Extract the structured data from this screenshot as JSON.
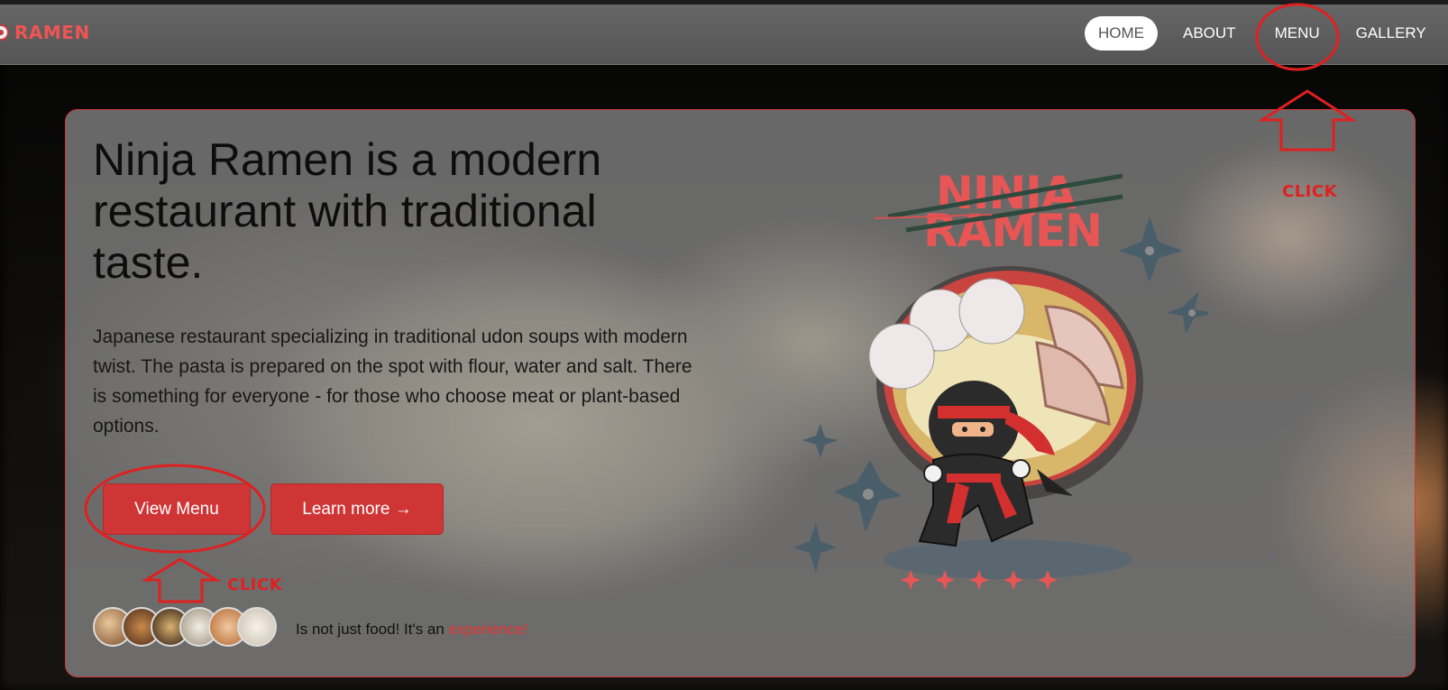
{
  "header": {
    "logo_text": "RAMEN",
    "nav": [
      {
        "label": "HOME",
        "active": true
      },
      {
        "label": "ABOUT",
        "active": false
      },
      {
        "label": "MENU",
        "active": false
      },
      {
        "label": "GALLERY",
        "active": false
      }
    ]
  },
  "hero": {
    "title": "Ninja Ramen is a modern restaurant with traditional taste.",
    "description": "Japanese restaurant specializing in traditional udon soups with modern twist. The pasta is prepared on the spot with flour, water and salt. There is something for everyone - for those who choose meat or plant-based options.",
    "primary_button": "View Menu",
    "secondary_button": "Learn more →",
    "tagline_prefix": "Is not just food! It's an ",
    "tagline_accent": "experience!",
    "brand_line1": "NINJA",
    "brand_line2": "RAMEN"
  },
  "annotations": {
    "menu_click_label": "CLICK",
    "button_click_label": "CLICK",
    "color": "#e02020"
  },
  "theme": {
    "accent": "#d03535",
    "card_border": "#d23a3a"
  }
}
